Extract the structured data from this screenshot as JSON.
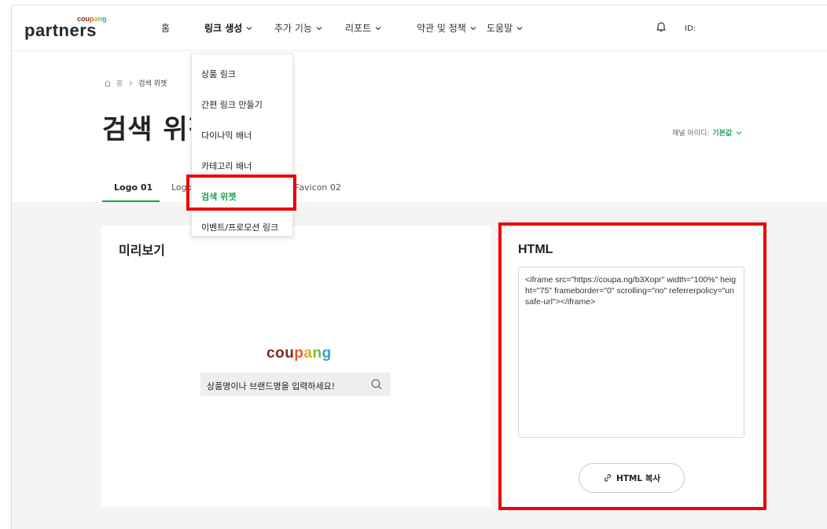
{
  "header": {
    "logo_small": [
      "cou",
      "p",
      "a",
      "n",
      "g"
    ],
    "logo_text": "partners",
    "nav": [
      {
        "label": "홈",
        "has_chevron": false
      },
      {
        "label": "링크 생성",
        "has_chevron": true,
        "active": true
      },
      {
        "label": "추가 기능",
        "has_chevron": true
      },
      {
        "label": "리포트",
        "has_chevron": true
      },
      {
        "label": "약관 및 정책",
        "has_chevron": true
      },
      {
        "label": "도움말",
        "has_chevron": true
      }
    ],
    "id_label": "ID:"
  },
  "dropdown": {
    "items": [
      {
        "label": "상품 링크"
      },
      {
        "label": "간편 링크 만들기"
      },
      {
        "label": "다이나믹 배너"
      },
      {
        "label": "카테고리 배너"
      },
      {
        "label": "검색 위젯",
        "selected": true
      },
      {
        "label": "이벤트/프로모션 링크"
      }
    ]
  },
  "breadcrumb": {
    "home": "홈",
    "current": "검색 위젯"
  },
  "page_title": "검색 위젯",
  "channel": {
    "label": "채널 아이디:",
    "value": "기본값"
  },
  "tabs": [
    {
      "label": "Logo 01",
      "active": true
    },
    {
      "label": "Logo 02"
    },
    {
      "label": "Favicon 02"
    }
  ],
  "preview": {
    "title": "미리보기",
    "widget_logo": [
      "c",
      "o",
      "u",
      "p",
      "a",
      "n",
      "g"
    ],
    "search_placeholder": "상품명이나 브랜드명을 입력하세요!"
  },
  "html_panel": {
    "title": "HTML",
    "code": "<iframe src=\"https://coupa.ng/b3Xopr\" width=\"100%\" height=\"75\" frameborder=\"0\" scrolling=\"no\" referrerpolicy=\"unsafe-url\"></iframe>",
    "copy_label": "HTML 복사"
  },
  "colors": {
    "accent_green": "#1aa34a",
    "annotation_red": "#ee0000",
    "page_gray": "#f4f4f4"
  }
}
